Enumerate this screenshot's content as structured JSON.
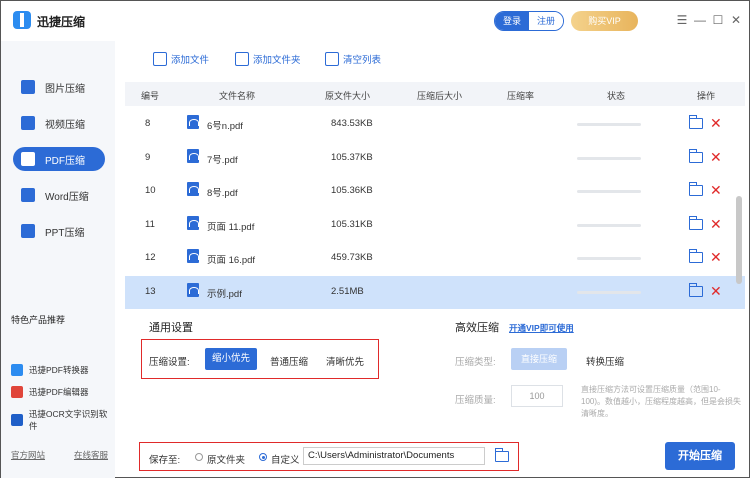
{
  "app": {
    "title": "迅捷压缩"
  },
  "auth": {
    "login": "登录",
    "register": "注册"
  },
  "vip": {
    "label": "购买VIP",
    "color": "#e8b45c"
  },
  "window_controls": {
    "menu": "☰",
    "minimize": "—",
    "maximize": "☐",
    "close": "✕"
  },
  "sidebar": {
    "items": [
      {
        "label": "图片压缩",
        "icon": "image-icon"
      },
      {
        "label": "视频压缩",
        "icon": "video-icon"
      },
      {
        "label": "PDF压缩",
        "icon": "pdf-icon",
        "active": true
      },
      {
        "label": "Word压缩",
        "icon": "word-icon"
      },
      {
        "label": "PPT压缩",
        "icon": "ppt-icon"
      }
    ],
    "featured_title": "特色产品推荐",
    "products": [
      {
        "label": "迅捷PDF转换器"
      },
      {
        "label": "迅捷PDF编辑器"
      },
      {
        "label": "迅捷OCR文字识别软件"
      }
    ],
    "footer": {
      "website": "官方网站",
      "support": "在线客服"
    }
  },
  "toolbar": {
    "add_file": "添加文件",
    "add_folder": "添加文件夹",
    "clear_list": "清空列表"
  },
  "table": {
    "headers": [
      "编号",
      "文件名称",
      "原文件大小",
      "压缩后大小",
      "压缩率",
      "状态",
      "操作"
    ],
    "rows": [
      {
        "id": "8",
        "name": "6号n.pdf",
        "size": "843.53KB",
        "compressed": "",
        "ratio": "",
        "progress": 0
      },
      {
        "id": "9",
        "name": "7号.pdf",
        "size": "105.37KB",
        "compressed": "",
        "ratio": "",
        "progress": 0
      },
      {
        "id": "10",
        "name": "8号.pdf",
        "size": "105.36KB",
        "compressed": "",
        "ratio": "",
        "progress": 0
      },
      {
        "id": "11",
        "name": "页面 11.pdf",
        "size": "105.31KB",
        "compressed": "",
        "ratio": "",
        "progress": 0
      },
      {
        "id": "12",
        "name": "页面 16.pdf",
        "size": "459.73KB",
        "compressed": "",
        "ratio": "",
        "progress": 0
      },
      {
        "id": "13",
        "name": "示例.pdf",
        "size": "2.51MB",
        "compressed": "",
        "ratio": "",
        "progress": 0,
        "selected": true
      }
    ]
  },
  "general": {
    "title": "通用设置",
    "label": "压缩设置:",
    "options": [
      "缩小优先",
      "普通压缩",
      "清晰优先"
    ],
    "selected": "缩小优先"
  },
  "advanced": {
    "title": "高效压缩",
    "vip_link": "开通VIP即可使用",
    "type_label": "压缩类型:",
    "type_options": [
      "直接压缩",
      "转换压缩"
    ],
    "quality_label": "压缩质量:",
    "quality_value": "100",
    "hint": "直接压缩方法可设置压缩质量（范围10-100)。数值越小，压缩程度越高，但是会损失清晰度。"
  },
  "save": {
    "label": "保存至:",
    "option_original": "原文件夹",
    "option_custom": "自定义",
    "selected": "自定义",
    "path": "C:\\Users\\Administrator\\Documents"
  },
  "start_button": "开始压缩",
  "colors": {
    "accent": "#2c6bd6",
    "danger": "#e02a2a",
    "selected_row": "#cfe2fb"
  }
}
